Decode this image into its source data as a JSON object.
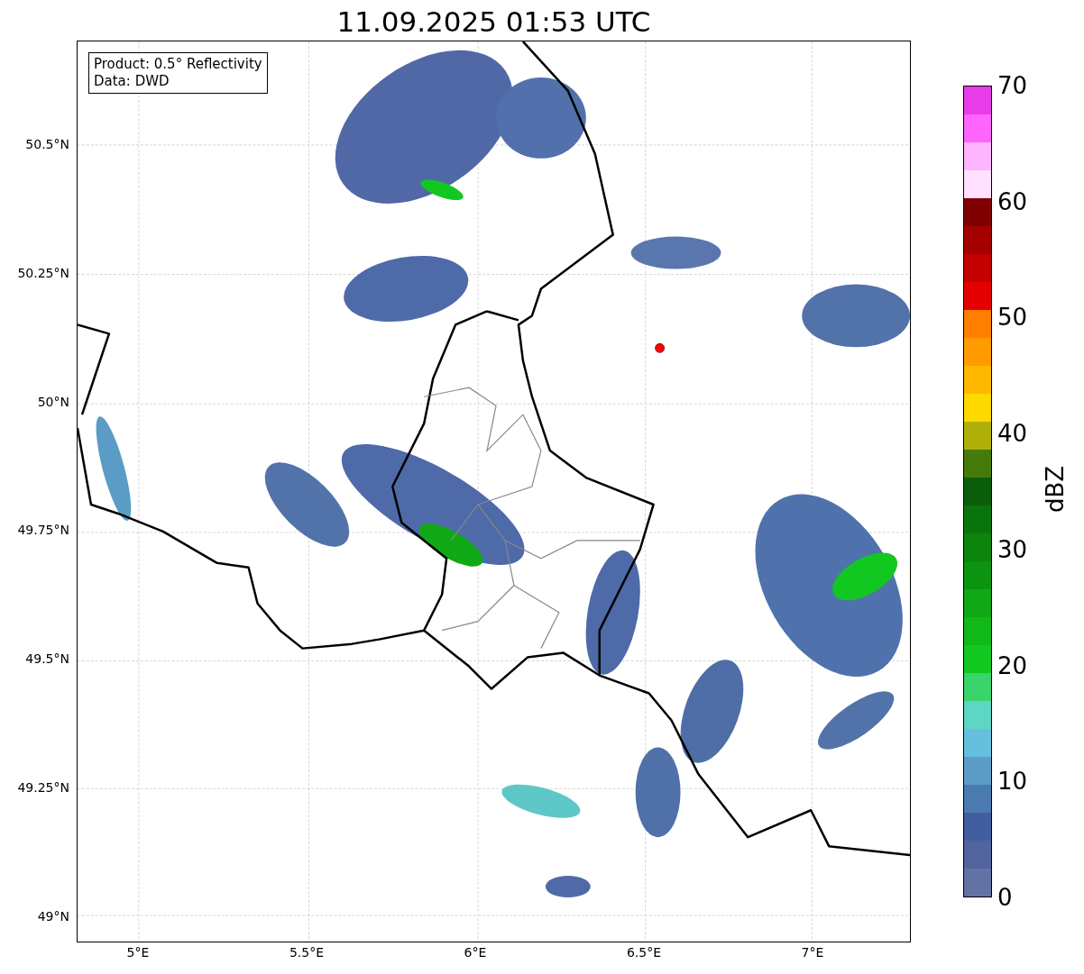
{
  "title": "11.09.2025 01:53 UTC",
  "info_box": {
    "lines": [
      "Product: 0.5° Reflectivity",
      "Data: DWD"
    ]
  },
  "y_axis": {
    "ticks": [
      "50.5°N",
      "50.25°N",
      "50°N",
      "49.75°N",
      "49.5°N",
      "49.25°N",
      "49°N"
    ]
  },
  "x_axis": {
    "ticks": [
      "5°E",
      "5.5°E",
      "6°E",
      "6.5°E",
      "7°E"
    ]
  },
  "colorbar": {
    "label": "dBZ",
    "ticks": [
      "70",
      "60",
      "50",
      "40",
      "30",
      "20",
      "10",
      "0"
    ],
    "bands": [
      {
        "color": "#6272a4"
      },
      {
        "color": "#52649c"
      },
      {
        "color": "#415ea0"
      },
      {
        "color": "#4a7ab0"
      },
      {
        "color": "#5a9cc6"
      },
      {
        "color": "#64c0dc"
      },
      {
        "color": "#5ed6c4"
      },
      {
        "color": "#3ad46a"
      },
      {
        "color": "#12c820"
      },
      {
        "color": "#10b818"
      },
      {
        "color": "#10a814"
      },
      {
        "color": "#0c9410"
      },
      {
        "color": "#0c840e"
      },
      {
        "color": "#0a740c"
      },
      {
        "color": "#0a5e0a"
      },
      {
        "color": "#467a0a"
      },
      {
        "color": "#b0b00a"
      },
      {
        "color": "#ffd800"
      },
      {
        "color": "#ffb800"
      },
      {
        "color": "#ff9a00"
      },
      {
        "color": "#ff7e00"
      },
      {
        "color": "#e40000"
      },
      {
        "color": "#c40000"
      },
      {
        "color": "#a40000"
      },
      {
        "color": "#7e0000"
      },
      {
        "color": "#ffe0ff"
      },
      {
        "color": "#ffb4ff"
      },
      {
        "color": "#ff64ff"
      },
      {
        "color": "#e83ce8"
      }
    ]
  }
}
